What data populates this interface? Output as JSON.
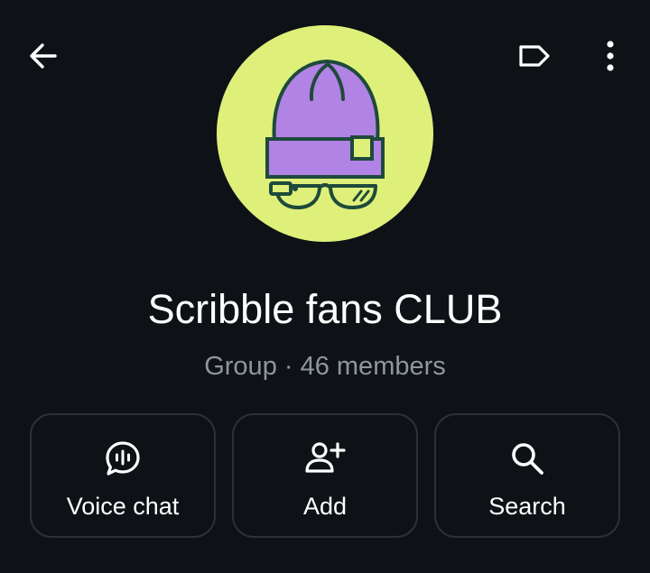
{
  "header": {
    "back_icon": "arrow-left-icon",
    "label_icon": "label-tag-icon",
    "more_icon": "more-vertical-icon"
  },
  "avatar": {
    "icon": "beanie-with-glasses-icon",
    "background": "#dff07a",
    "hat_color": "#b183e4",
    "outline_color": "#1e4a3c"
  },
  "group": {
    "title": "Scribble fans CLUB",
    "subtitle": "Group · 46 members"
  },
  "actions": [
    {
      "label": "Voice chat",
      "icon": "voice-chat-icon"
    },
    {
      "label": "Add",
      "icon": "add-person-icon"
    },
    {
      "label": "Search",
      "icon": "search-icon"
    }
  ],
  "colors": {
    "background": "#0e1216",
    "button_border": "#2b3137",
    "text_primary": "#ffffff",
    "text_secondary": "#8f969c"
  }
}
